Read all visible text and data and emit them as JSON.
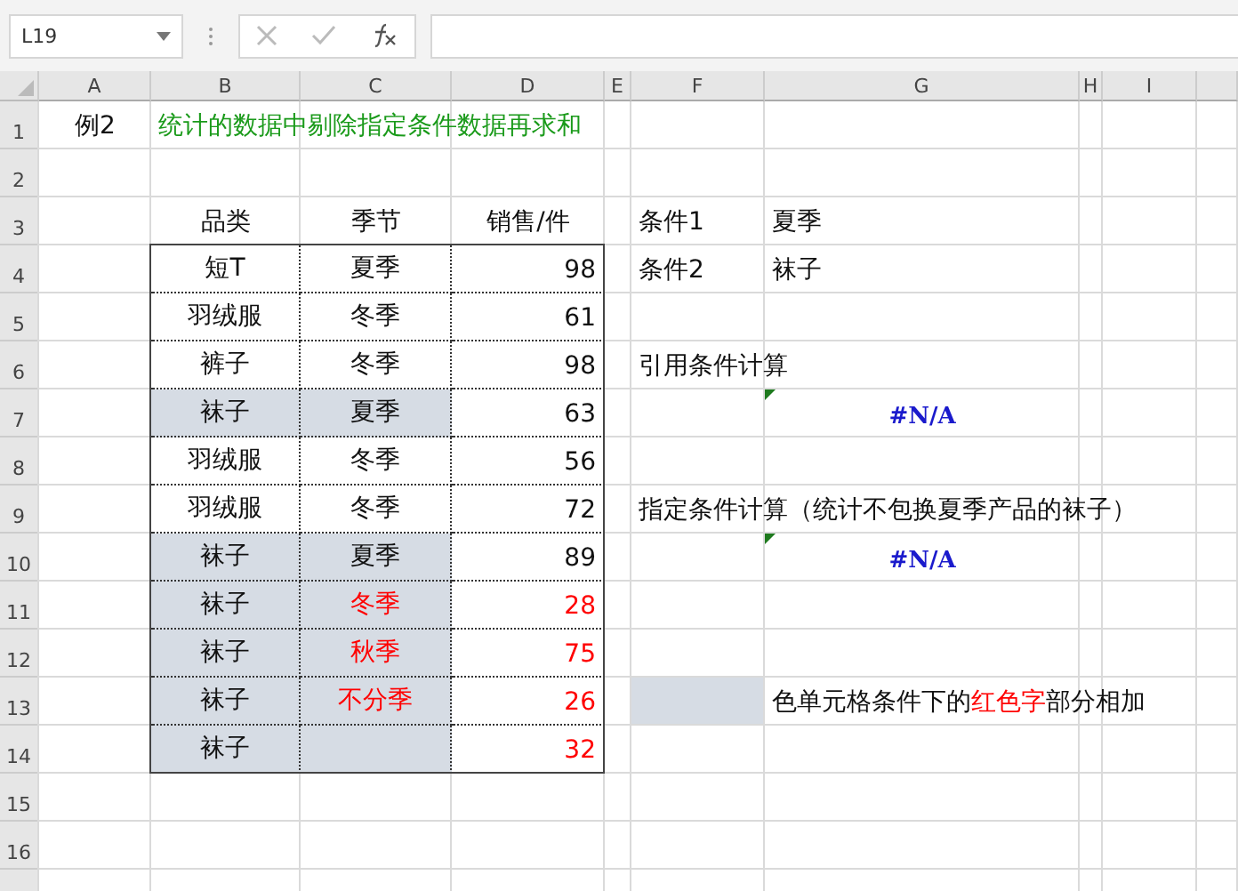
{
  "name_box": "L19",
  "column_headers": [
    "A",
    "B",
    "C",
    "D",
    "E",
    "F",
    "G",
    "H",
    "I"
  ],
  "row_headers": [
    "1",
    "2",
    "3",
    "4",
    "5",
    "6",
    "7",
    "8",
    "9",
    "10",
    "11",
    "12",
    "13",
    "14",
    "15",
    "16"
  ],
  "example_label": "例2",
  "title": "统计的数据中剔除指定条件数据再求和",
  "sales_table": {
    "headers": [
      "品类",
      "季节",
      "销售/件"
    ],
    "rows": [
      {
        "category": "短T",
        "season": "夏季",
        "sales": "98",
        "shaded": false,
        "highlighted": false
      },
      {
        "category": "羽绒服",
        "season": "冬季",
        "sales": "61",
        "shaded": false,
        "highlighted": false
      },
      {
        "category": "裤子",
        "season": "冬季",
        "sales": "98",
        "shaded": false,
        "highlighted": false
      },
      {
        "category": "袜子",
        "season": "夏季",
        "sales": "63",
        "shaded": true,
        "highlighted": false
      },
      {
        "category": "羽绒服",
        "season": "冬季",
        "sales": "56",
        "shaded": false,
        "highlighted": false
      },
      {
        "category": "羽绒服",
        "season": "冬季",
        "sales": "72",
        "shaded": false,
        "highlighted": false
      },
      {
        "category": "袜子",
        "season": "夏季",
        "sales": "89",
        "shaded": true,
        "highlighted": false
      },
      {
        "category": "袜子",
        "season": "冬季",
        "sales": "28",
        "shaded": true,
        "highlighted": true
      },
      {
        "category": "袜子",
        "season": "秋季",
        "sales": "75",
        "shaded": true,
        "highlighted": true
      },
      {
        "category": "袜子",
        "season": "不分季",
        "sales": "26",
        "shaded": true,
        "highlighted": true
      },
      {
        "category": "袜子",
        "sales": "32",
        "shaded": true,
        "highlighted": true
      }
    ]
  },
  "conditions": [
    {
      "label": "条件1",
      "value": "夏季"
    },
    {
      "label": "条件2",
      "value": "袜子"
    }
  ],
  "calculations": [
    {
      "heading": "引用条件计算",
      "result": "#N/A"
    },
    {
      "heading": "指定条件计算（统计不包换夏季产品的袜子）",
      "result": "#N/A"
    }
  ],
  "legend": {
    "segments": [
      {
        "text": "色单元格条件下的",
        "highlighted": false
      },
      {
        "text": "红色字",
        "highlighted": true
      },
      {
        "text": "部分相加",
        "highlighted": false
      }
    ]
  }
}
